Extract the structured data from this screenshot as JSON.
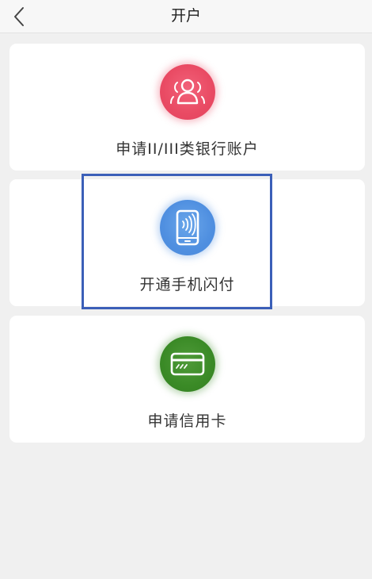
{
  "header": {
    "title": "开户",
    "back_icon": "chevron-left-icon"
  },
  "options": [
    {
      "label": "申请II/III类银行账户",
      "icon": "users-icon",
      "color": "#e94a63"
    },
    {
      "label": "开通手机闪付",
      "icon": "nfc-phone-icon",
      "color": "#4f8fe0"
    },
    {
      "label": "申请信用卡",
      "icon": "credit-card-icon",
      "color": "#3a8a26"
    }
  ],
  "highlight": {
    "target": "开通手机闪付",
    "color": "#3b5fb8"
  }
}
